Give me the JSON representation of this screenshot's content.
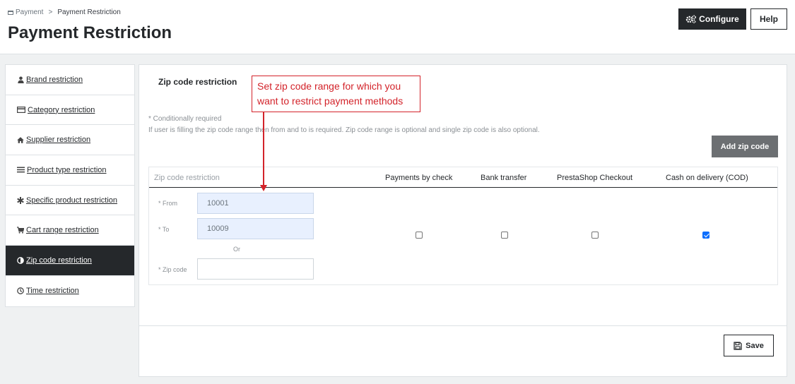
{
  "breadcrumb": {
    "parent": "Payment",
    "separator": ">",
    "current": "Payment Restriction"
  },
  "page_title": "Payment Restriction",
  "toolbar": {
    "configure_label": "Configure",
    "help_label": "Help"
  },
  "sidebar": {
    "items": [
      {
        "label": "Brand restriction",
        "icon": "user-icon"
      },
      {
        "label": "Category restriction",
        "icon": "credit-card-icon"
      },
      {
        "label": "Supplier restriction",
        "icon": "home-icon"
      },
      {
        "label": "Product type restriction",
        "icon": "list-icon"
      },
      {
        "label": "Specific product restriction",
        "icon": "asterisk-icon"
      },
      {
        "label": "Cart range restriction",
        "icon": "cart-icon"
      },
      {
        "label": "Zip code restriction",
        "icon": "half-circle-icon",
        "active": true
      },
      {
        "label": "Time restriction",
        "icon": "clock-icon"
      }
    ]
  },
  "panel": {
    "title": "Zip code restriction",
    "note_required": "* Conditionally required",
    "note_description": "If user is filling the zip code range then from and to is required. Zip code range is optional and single zip code is also optional.",
    "add_button": "Add zip code",
    "table": {
      "headers": [
        "Zip code restriction",
        "Payments by check",
        "Bank transfer",
        "PrestaShop Checkout",
        "Cash on delivery (COD)"
      ],
      "from_label": "* From",
      "from_value": "10001",
      "to_label": "* To",
      "to_value": "10009",
      "or_label": "Or",
      "zip_label": "* Zip code",
      "zip_value": "",
      "payments": [
        {
          "name": "Payments by check",
          "checked": false
        },
        {
          "name": "Bank transfer",
          "checked": false
        },
        {
          "name": "PrestaShop Checkout",
          "checked": false
        },
        {
          "name": "Cash on delivery (COD)",
          "checked": true
        }
      ]
    },
    "save_label": "Save"
  },
  "callout": {
    "text": "Set zip code range for which you want to restrict payment methods"
  },
  "colors": {
    "accent_dark": "#25282b",
    "annotation_red": "#d3232a",
    "checkbox_blue": "#0d6efd"
  }
}
